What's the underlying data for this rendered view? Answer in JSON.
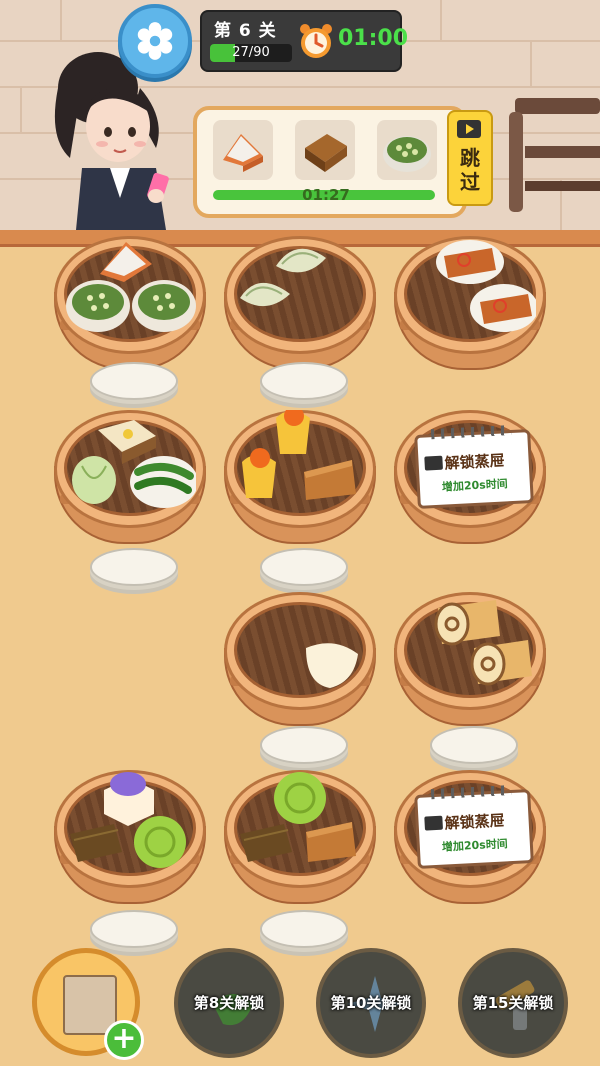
{
  "hud": {
    "level_title": "第 6 关",
    "progress_text": "27/90",
    "progress_fraction": 0.3,
    "timer": "01:00",
    "settings_icon": "gear-icon",
    "timer_icon": "alarm-clock-icon"
  },
  "order": {
    "items": [
      "cake-slice-icon",
      "jujube-cake-icon",
      "green-soup-icon"
    ],
    "timer": "01:27",
    "skip_label": "跳过",
    "skip_icon": "video-icon"
  },
  "steamers": [
    {
      "id": "r1c1",
      "locked": false
    },
    {
      "id": "r1c2",
      "locked": false
    },
    {
      "id": "r1c3",
      "locked": false
    },
    {
      "id": "r2c1",
      "locked": false
    },
    {
      "id": "r2c2",
      "locked": false
    },
    {
      "id": "r2c3",
      "locked": true,
      "title": "解锁蒸屉",
      "subtitle": "增加20s时间"
    },
    {
      "id": "r3c2",
      "locked": false
    },
    {
      "id": "r3c3",
      "locked": false
    },
    {
      "id": "r4c1",
      "locked": false
    },
    {
      "id": "r4c2",
      "locked": false
    },
    {
      "id": "r4c3",
      "locked": true,
      "title": "解锁蒸屉",
      "subtitle": "增加20s时间"
    }
  ],
  "tools": {
    "bag_icon": "takeout-bag-icon",
    "plus_icon": "plus-icon",
    "locked": [
      {
        "label": "第8关解锁",
        "icon": "pepper-icon"
      },
      {
        "label": "第10关解锁",
        "icon": "ice-icon"
      },
      {
        "label": "第15关解锁",
        "icon": "spray-gun-icon"
      }
    ]
  },
  "colors": {
    "accent_green": "#48c23a",
    "hud_bg": "#3a3a3a",
    "steamer": "#f1b57c",
    "skip_yellow": "#fcd33a"
  }
}
